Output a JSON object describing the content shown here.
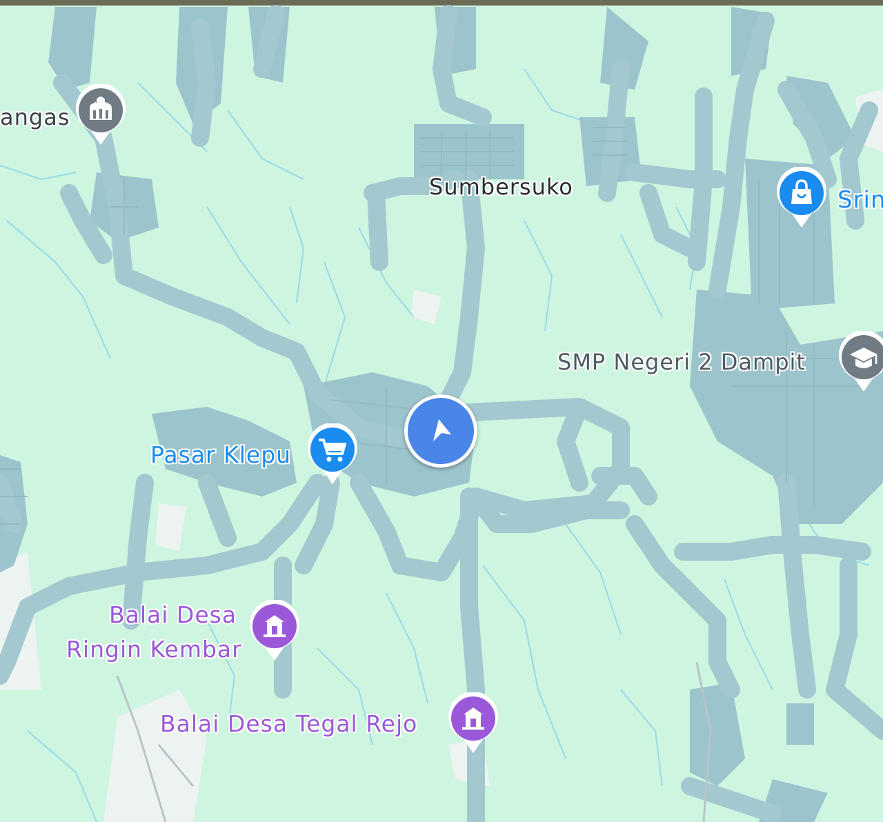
{
  "map": {
    "colors": {
      "land": "#cdf5e0",
      "settlement": "#9cc4cc",
      "road": "#a9cdd1",
      "water": "#8fd6e8",
      "open": "#f2f4f3",
      "shop_blue": "#1a8cf0",
      "civic_purple": "#9b59d9",
      "gray": "#707b84",
      "location": "#4a86e8"
    },
    "labels": {
      "sumbersuko": "Sumbersuko",
      "langas": "angas",
      "srin": "Srin",
      "smp": "SMP Negeri 2 Dampit",
      "pasar": "Pasar Klepu",
      "balai_ringin_line1": "Balai Desa",
      "balai_ringin_line2": "Ringin Kembar",
      "balai_tegal": "Balai Desa Tegal Rejo"
    },
    "icons": {
      "temple": "temple-icon",
      "shopping": "shopping-bag-icon",
      "school": "graduation-cap-icon",
      "cart": "shopping-cart-icon",
      "village_hall": "government-building-icon",
      "navigation": "navigation-arrow-icon"
    }
  }
}
